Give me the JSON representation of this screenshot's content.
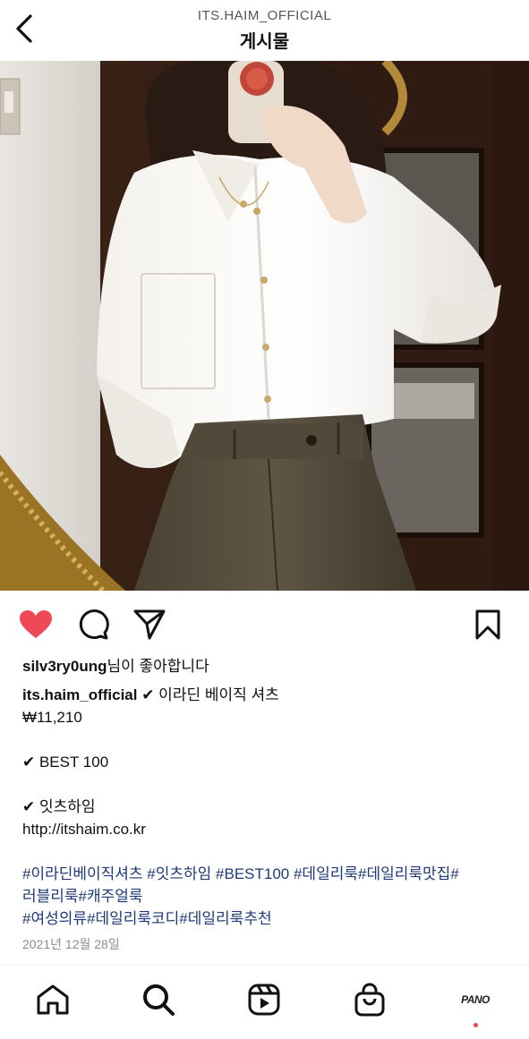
{
  "header": {
    "account": "ITS.HAIM_OFFICIAL",
    "title": "게시물"
  },
  "post": {
    "photo_alt": "",
    "liked": true,
    "likes_line": {
      "user": "silv3ry0ung",
      "suffix": "님이 좋아합니다"
    },
    "caption": {
      "author": "its.haim_official",
      "first_line": " ✔ 이라딘 베이직 셔츠",
      "lines": [
        "₩11,210",
        "",
        "✔ BEST 100",
        "",
        "✔ 잇츠하임",
        "http://itshaim.co.kr",
        ""
      ],
      "hashtag_lines": [
        "#이라딘베이직셔츠 #잇츠하임 #BEST100 #데일리룩#데일리룩맛집#",
        "러블리룩#캐주얼룩",
        "#여성의류#데일리룩코디#데일리룩추천"
      ]
    },
    "date": "2021년 12월 28일"
  },
  "tabbar": {
    "profile_label": "PANO"
  },
  "colors": {
    "like": "#ed4956",
    "hashtag": "#1f3a78",
    "muted": "#8e8e8e"
  }
}
